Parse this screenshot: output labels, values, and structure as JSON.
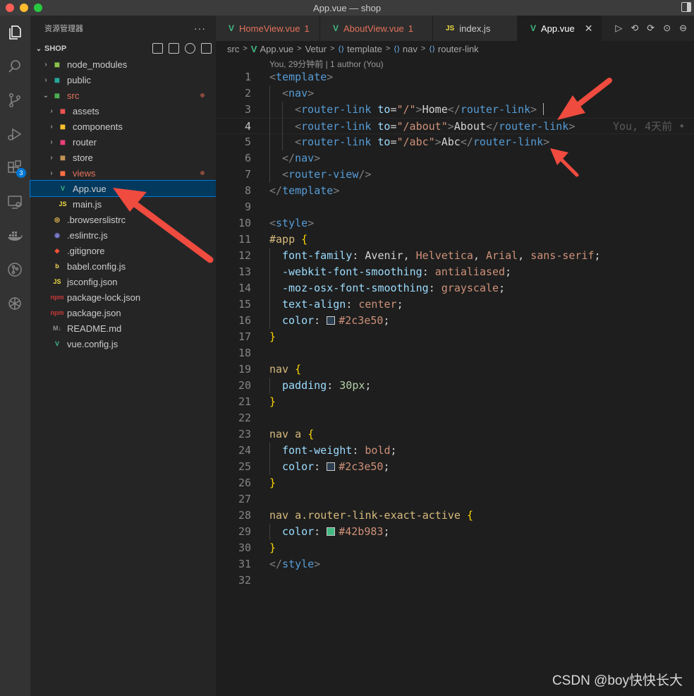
{
  "window": {
    "title": "App.vue — shop"
  },
  "activity_bar": {
    "icons": [
      "explorer-icon",
      "search-icon",
      "source-control-icon",
      "run-debug-icon",
      "extensions-icon",
      "remote-explorer-icon",
      "docker-icon",
      "git-graph-icon",
      "openai-icon"
    ],
    "extensions_badge": "3"
  },
  "sidebar": {
    "title": "资源管理器",
    "more": "···",
    "project": "SHOP",
    "items": [
      {
        "label": "node_modules",
        "icon": "folder-node-icon",
        "twisty": "›",
        "indent": 1,
        "color": "#cccccc"
      },
      {
        "label": "public",
        "icon": "folder-public-icon",
        "twisty": "›",
        "indent": 1,
        "color": "#cccccc"
      },
      {
        "label": "src",
        "icon": "folder-src-icon",
        "twisty": "⌄",
        "indent": 1,
        "modified": true
      },
      {
        "label": "assets",
        "icon": "folder-assets-icon",
        "twisty": "›",
        "indent": 2
      },
      {
        "label": "components",
        "icon": "folder-components-icon",
        "twisty": "›",
        "indent": 2
      },
      {
        "label": "router",
        "icon": "folder-router-icon",
        "twisty": "›",
        "indent": 2
      },
      {
        "label": "store",
        "icon": "folder-store-icon",
        "twisty": "›",
        "indent": 2
      },
      {
        "label": "views",
        "icon": "folder-views-icon",
        "twisty": "›",
        "indent": 2,
        "modified": true
      },
      {
        "label": "App.vue",
        "icon": "vue-file-icon",
        "twisty": "",
        "indent": 2,
        "selected": true
      },
      {
        "label": "main.js",
        "icon": "js-file-icon",
        "twisty": "",
        "indent": 2
      },
      {
        "label": ".browserslistrc",
        "icon": "browserslist-file-icon",
        "twisty": "",
        "indent": 1
      },
      {
        "label": ".eslintrc.js",
        "icon": "eslint-file-icon",
        "twisty": "",
        "indent": 1
      },
      {
        "label": ".gitignore",
        "icon": "git-file-icon",
        "twisty": "",
        "indent": 1
      },
      {
        "label": "babel.config.js",
        "icon": "babel-file-icon",
        "twisty": "",
        "indent": 1
      },
      {
        "label": "jsconfig.json",
        "icon": "js-file-icon",
        "twisty": "",
        "indent": 1
      },
      {
        "label": "package-lock.json",
        "icon": "npm-file-icon",
        "twisty": "",
        "indent": 1
      },
      {
        "label": "package.json",
        "icon": "npm-file-icon",
        "twisty": "",
        "indent": 1
      },
      {
        "label": "README.md",
        "icon": "markdown-file-icon",
        "twisty": "",
        "indent": 1
      },
      {
        "label": "vue.config.js",
        "icon": "vue-file-icon",
        "twisty": "",
        "indent": 1
      }
    ]
  },
  "tabs": [
    {
      "label": "HomeView.vue",
      "problems": "1",
      "icon": "vue-file-icon",
      "modified": true
    },
    {
      "label": "AboutView.vue",
      "problems": "1",
      "icon": "vue-file-icon",
      "modified": true
    },
    {
      "label": "index.js",
      "problems": "",
      "icon": "js-file-icon",
      "modified": false
    },
    {
      "label": "App.vue",
      "problems": "",
      "icon": "vue-file-icon",
      "modified": false,
      "active": true,
      "close": "✕"
    }
  ],
  "breadcrumb": [
    "src",
    "App.vue",
    "Vetur",
    "template",
    "nav",
    "router-link"
  ],
  "editor": {
    "codelens": "You, 29分钟前 | 1 author (You)",
    "blame": "You, 4天前 • :",
    "current_line": 4,
    "lines": [
      {
        "n": "1",
        "indent": 0,
        "tokens": [
          [
            "t-br",
            "<"
          ],
          [
            "t-tag",
            "template"
          ],
          [
            "t-br",
            ">"
          ]
        ]
      },
      {
        "n": "2",
        "indent": 1,
        "tokens": [
          [
            "t-br",
            "<"
          ],
          [
            "t-tag",
            "nav"
          ],
          [
            "t-br",
            ">"
          ]
        ]
      },
      {
        "n": "3",
        "indent": 2,
        "tokens": [
          [
            "t-br",
            "<"
          ],
          [
            "t-tag",
            "router-link "
          ],
          [
            "t-attr",
            "to"
          ],
          [
            "t-punct",
            "="
          ],
          [
            "t-str",
            "\"/\""
          ],
          [
            "t-br",
            ">"
          ],
          [
            "t-txt",
            "Home"
          ],
          [
            "t-br",
            "</"
          ],
          [
            "t-tag",
            "router-link"
          ],
          [
            "t-br",
            ">"
          ],
          [
            "t-txt",
            " "
          ]
        ],
        "cursor": true
      },
      {
        "n": "4",
        "indent": 2,
        "tokens": [
          [
            "t-br",
            "<"
          ],
          [
            "t-tag",
            "router-link "
          ],
          [
            "t-attr",
            "to"
          ],
          [
            "t-punct",
            "="
          ],
          [
            "t-str",
            "\"/about\""
          ],
          [
            "t-br",
            ">"
          ],
          [
            "t-txt",
            "About"
          ],
          [
            "t-br",
            "</"
          ],
          [
            "t-tag",
            "router-link"
          ],
          [
            "t-br",
            ">"
          ]
        ]
      },
      {
        "n": "5",
        "indent": 2,
        "tokens": [
          [
            "t-br",
            "<"
          ],
          [
            "t-tag",
            "router-link "
          ],
          [
            "t-attr",
            "to"
          ],
          [
            "t-punct",
            "="
          ],
          [
            "t-str",
            "\"/abc\""
          ],
          [
            "t-br",
            ">"
          ],
          [
            "t-txt",
            "Abc"
          ],
          [
            "t-br",
            "</"
          ],
          [
            "t-tag",
            "router-link"
          ],
          [
            "t-br",
            ">"
          ]
        ]
      },
      {
        "n": "6",
        "indent": 1,
        "tokens": [
          [
            "t-br",
            "</"
          ],
          [
            "t-tag",
            "nav"
          ],
          [
            "t-br",
            ">"
          ]
        ]
      },
      {
        "n": "7",
        "indent": 1,
        "tokens": [
          [
            "t-br",
            "<"
          ],
          [
            "t-tag",
            "router-view"
          ],
          [
            "t-br",
            "/>"
          ]
        ]
      },
      {
        "n": "8",
        "indent": 0,
        "tokens": [
          [
            "t-br",
            "</"
          ],
          [
            "t-tag",
            "template"
          ],
          [
            "t-br",
            ">"
          ]
        ]
      },
      {
        "n": "9",
        "indent": 0,
        "tokens": []
      },
      {
        "n": "10",
        "indent": 0,
        "tokens": [
          [
            "t-br",
            "<"
          ],
          [
            "t-tag",
            "style"
          ],
          [
            "t-br",
            ">"
          ]
        ]
      },
      {
        "n": "11",
        "indent": 0,
        "tokens": [
          [
            "t-sel",
            "#app "
          ],
          [
            "t-brace",
            "{"
          ]
        ]
      },
      {
        "n": "12",
        "indent": 1,
        "tokens": [
          [
            "t-prop",
            "font-family"
          ],
          [
            "t-punct",
            ": "
          ],
          [
            "t-txt",
            "Avenir"
          ],
          [
            "t-punct",
            ", "
          ],
          [
            "t-val",
            "Helvetica"
          ],
          [
            "t-punct",
            ", "
          ],
          [
            "t-val",
            "Arial"
          ],
          [
            "t-punct",
            ", "
          ],
          [
            "t-val",
            "sans-serif"
          ],
          [
            "t-punct",
            ";"
          ]
        ]
      },
      {
        "n": "13",
        "indent": 1,
        "tokens": [
          [
            "t-prop",
            "-webkit-font-smoothing"
          ],
          [
            "t-punct",
            ": "
          ],
          [
            "t-val",
            "antialiased"
          ],
          [
            "t-punct",
            ";"
          ]
        ]
      },
      {
        "n": "14",
        "indent": 1,
        "tokens": [
          [
            "t-prop",
            "-moz-osx-font-smoothing"
          ],
          [
            "t-punct",
            ": "
          ],
          [
            "t-val",
            "grayscale"
          ],
          [
            "t-punct",
            ";"
          ]
        ]
      },
      {
        "n": "15",
        "indent": 1,
        "tokens": [
          [
            "t-prop",
            "text-align"
          ],
          [
            "t-punct",
            ": "
          ],
          [
            "t-val",
            "center"
          ],
          [
            "t-punct",
            ";"
          ]
        ]
      },
      {
        "n": "16",
        "indent": 1,
        "tokens": [
          [
            "t-prop",
            "color"
          ],
          [
            "t-punct",
            ": "
          ],
          [
            "swatch",
            "#2c3e50"
          ],
          [
            "t-val",
            "#2c3e50"
          ],
          [
            "t-punct",
            ";"
          ]
        ]
      },
      {
        "n": "17",
        "indent": 0,
        "tokens": [
          [
            "t-brace",
            "}"
          ]
        ]
      },
      {
        "n": "18",
        "indent": 0,
        "tokens": []
      },
      {
        "n": "19",
        "indent": 0,
        "tokens": [
          [
            "t-sel",
            "nav "
          ],
          [
            "t-brace",
            "{"
          ]
        ]
      },
      {
        "n": "20",
        "indent": 1,
        "tokens": [
          [
            "t-prop",
            "padding"
          ],
          [
            "t-punct",
            ": "
          ],
          [
            "t-num",
            "30px"
          ],
          [
            "t-punct",
            ";"
          ]
        ]
      },
      {
        "n": "21",
        "indent": 0,
        "tokens": [
          [
            "t-brace",
            "}"
          ]
        ]
      },
      {
        "n": "22",
        "indent": 0,
        "tokens": []
      },
      {
        "n": "23",
        "indent": 0,
        "tokens": [
          [
            "t-sel",
            "nav a "
          ],
          [
            "t-brace",
            "{"
          ]
        ]
      },
      {
        "n": "24",
        "indent": 1,
        "tokens": [
          [
            "t-prop",
            "font-weight"
          ],
          [
            "t-punct",
            ": "
          ],
          [
            "t-val",
            "bold"
          ],
          [
            "t-punct",
            ";"
          ]
        ]
      },
      {
        "n": "25",
        "indent": 1,
        "tokens": [
          [
            "t-prop",
            "color"
          ],
          [
            "t-punct",
            ": "
          ],
          [
            "swatch",
            "#2c3e50"
          ],
          [
            "t-val",
            "#2c3e50"
          ],
          [
            "t-punct",
            ";"
          ]
        ]
      },
      {
        "n": "26",
        "indent": 0,
        "tokens": [
          [
            "t-brace",
            "}"
          ]
        ]
      },
      {
        "n": "27",
        "indent": 0,
        "tokens": []
      },
      {
        "n": "28",
        "indent": 0,
        "tokens": [
          [
            "t-sel",
            "nav a.router-link-exact-active "
          ],
          [
            "t-brace",
            "{"
          ]
        ]
      },
      {
        "n": "29",
        "indent": 1,
        "tokens": [
          [
            "t-prop",
            "color"
          ],
          [
            "t-punct",
            ": "
          ],
          [
            "swatch",
            "#42b983"
          ],
          [
            "t-val",
            "#42b983"
          ],
          [
            "t-punct",
            ";"
          ]
        ]
      },
      {
        "n": "30",
        "indent": 0,
        "tokens": [
          [
            "t-brace",
            "}"
          ]
        ]
      },
      {
        "n": "31",
        "indent": 0,
        "tokens": [
          [
            "t-br",
            "</"
          ],
          [
            "t-tag",
            "style"
          ],
          [
            "t-br",
            ">"
          ]
        ]
      },
      {
        "n": "32",
        "indent": 0,
        "tokens": []
      }
    ]
  },
  "annotation_color": "#ef4b3f",
  "watermark": "CSDN @boy快快长大"
}
